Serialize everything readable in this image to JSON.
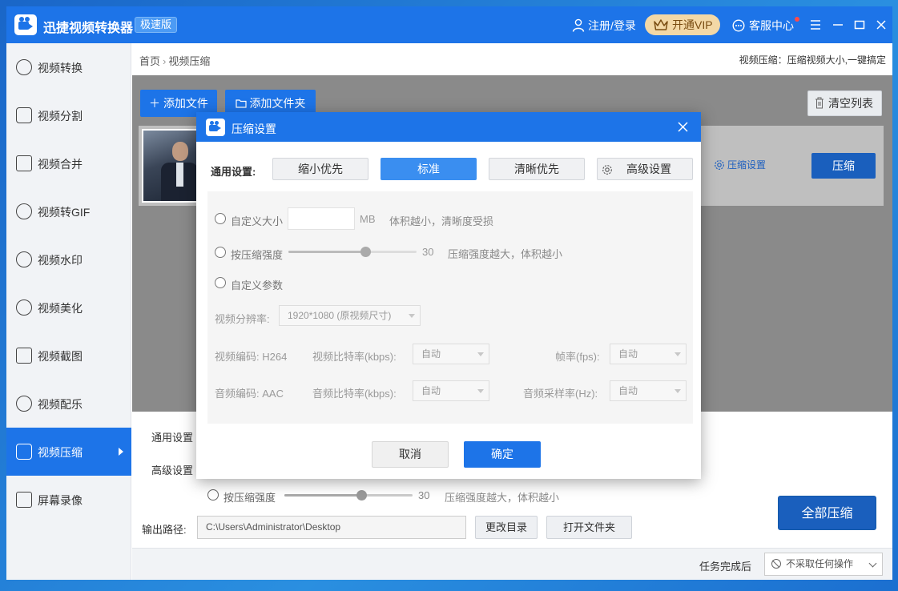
{
  "app": {
    "title": "迅捷视频转换器",
    "edition": "极速版",
    "login": "注册/登录",
    "vip": "开通VIP",
    "service": "客服中心"
  },
  "sidebar": {
    "items": [
      {
        "label": "视频转换",
        "icon": "convert-icon"
      },
      {
        "label": "视频分割",
        "icon": "split-icon"
      },
      {
        "label": "视频合并",
        "icon": "merge-icon"
      },
      {
        "label": "视频转GIF",
        "icon": "gif-icon"
      },
      {
        "label": "视频水印",
        "icon": "watermark-icon"
      },
      {
        "label": "视频美化",
        "icon": "beautify-icon"
      },
      {
        "label": "视频截图",
        "icon": "screenshot-icon"
      },
      {
        "label": "视频配乐",
        "icon": "music-icon"
      },
      {
        "label": "视频压缩",
        "icon": "compress-icon",
        "active": true
      },
      {
        "label": "屏幕录像",
        "icon": "record-icon"
      }
    ]
  },
  "main": {
    "breadcrumb": {
      "home": "首页",
      "sep": "›",
      "current": "视频压缩"
    },
    "tip": "视频压缩：压缩视频大小,一键搞定",
    "add_file": "添加文件",
    "add_folder": "添加文件夹",
    "clear_list": "清空列表",
    "file_compress_settings": "压缩设置",
    "file_compress": "压缩"
  },
  "bottom": {
    "general_label": "通用设置",
    "advanced_label": "高级设置",
    "strength_label": "按压缩强度",
    "strength_value": "30",
    "strength_fraction": 0.6,
    "strength_desc": "压缩强度越大，体积越小",
    "output_label": "输出路径:",
    "output_path": "C:\\Users\\Administrator\\Desktop",
    "change_dir": "更改目录",
    "open_folder": "打开文件夹",
    "compress_all": "全部压缩",
    "after_label": "任务完成后",
    "after_value": "不采取任何操作"
  },
  "dialog": {
    "title": "压缩设置",
    "preset_label": "通用设置:",
    "presets": [
      "缩小优先",
      "标准",
      "清晰优先",
      "高级设置"
    ],
    "selected_preset": "标准",
    "custom_size_label": "自定义大小",
    "custom_size_value": "",
    "size_unit": "MB",
    "size_desc": "体积越小，清晰度受损",
    "strength_label": "按压缩强度",
    "strength_value": "30",
    "strength_fraction": 0.6,
    "strength_desc": "压缩强度越大，体积越小",
    "custom_params_label": "自定义参数",
    "resolution_label": "视频分辨率:",
    "resolution_value": "1920*1080 (原视频尺寸)",
    "video_codec": "视频编码: H264",
    "video_bitrate_label": "视频比特率(kbps):",
    "video_bitrate_value": "自动",
    "fps_label": "帧率(fps):",
    "fps_value": "自动",
    "audio_codec": "音频编码: AAC",
    "audio_bitrate_label": "音频比特率(kbps):",
    "audio_bitrate_value": "自动",
    "audio_samplerate_label": "音频采样率(Hz):",
    "audio_samplerate_value": "自动",
    "cancel": "取消",
    "ok": "确定"
  }
}
